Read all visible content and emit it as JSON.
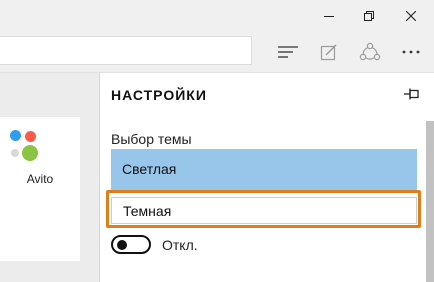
{
  "toolbar": {
    "hub_icon": "hub-icon",
    "note_icon": "web-note-icon",
    "share_icon": "share-icon",
    "more_icon": "more-icon"
  },
  "page": {
    "tile_label": "Avito",
    "logo_colors": [
      "#2e9cf0",
      "#ff5a4a",
      "#d9d9d9",
      "#89c540"
    ]
  },
  "settings": {
    "title": "НАСТРОЙКИ",
    "theme_label": "Выбор темы",
    "theme_selected": "Светлая",
    "theme_option_dark": "Темная",
    "toggle_label": "Откл.",
    "accent_color": "#98c5ea",
    "highlight_color": "#e07e1c"
  }
}
